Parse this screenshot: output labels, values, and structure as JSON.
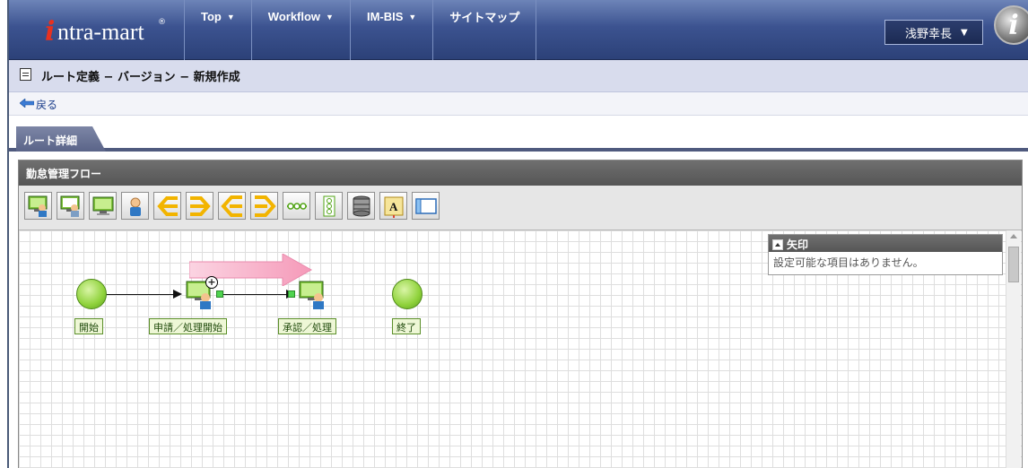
{
  "app": {
    "brand": "ntra-mart",
    "brand_mark": "i",
    "reg": "®",
    "corner_mark": "i"
  },
  "nav": [
    {
      "label": "Top",
      "caret": "▼"
    },
    {
      "label": "Workflow",
      "caret": "▼"
    },
    {
      "label": "IM-BIS",
      "caret": "▼"
    },
    {
      "label": "サイトマップ",
      "caret": ""
    }
  ],
  "user": {
    "name": "浅野幸長",
    "caret": "▼"
  },
  "page": {
    "title": "ルート定義 − バージョン − 新規作成",
    "back_label": "戻る"
  },
  "tab": {
    "label": "ルート詳細"
  },
  "panel": {
    "title": "勤怠管理フロー"
  },
  "toolbar": {
    "tools": [
      "user-screen-icon",
      "user-screen-alt-icon",
      "screen-icon",
      "person-icon",
      "branch-left-icon",
      "branch-right-icon",
      "merge-left-icon",
      "merge-right-icon",
      "chain-icon",
      "vertical-chain-icon",
      "database-icon",
      "text-annotation-icon",
      "window-icon"
    ]
  },
  "flow": {
    "nodes": [
      {
        "id": "start",
        "label": "開始",
        "type": "start"
      },
      {
        "id": "apply",
        "label": "申請／処理開始",
        "type": "task"
      },
      {
        "id": "approve",
        "label": "承認／処理",
        "type": "task"
      },
      {
        "id": "end",
        "label": "終了",
        "type": "end"
      }
    ],
    "plus_badge": "+"
  },
  "property_box": {
    "title": "矢印",
    "body": "設定可能な項目はありません。"
  },
  "colors": {
    "header": "#3c5390",
    "accent_red": "#e8311f",
    "node_green": "#8fd23b",
    "arrow_pink": "#f6a5c0"
  }
}
